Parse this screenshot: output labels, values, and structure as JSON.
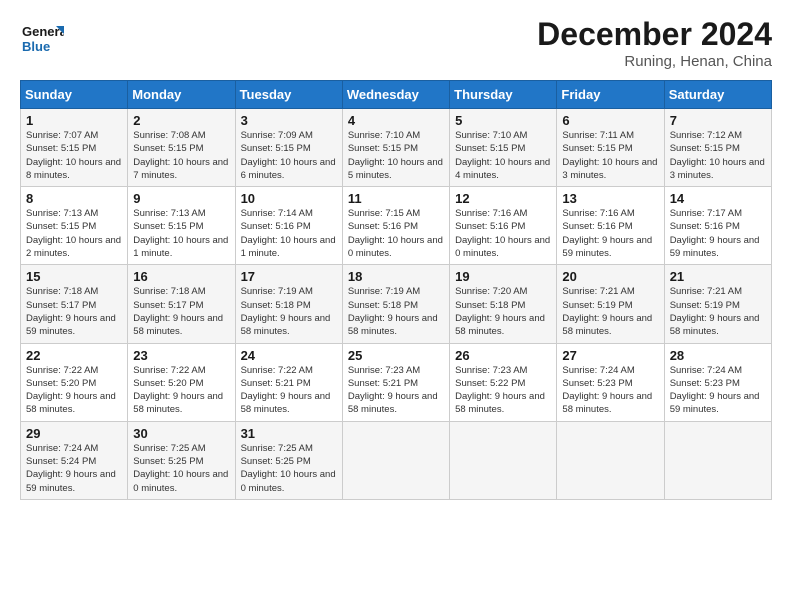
{
  "logo": {
    "general": "General",
    "blue": "Blue"
  },
  "header": {
    "title": "December 2024",
    "location": "Runing, Henan, China"
  },
  "weekdays": [
    "Sunday",
    "Monday",
    "Tuesday",
    "Wednesday",
    "Thursday",
    "Friday",
    "Saturday"
  ],
  "weeks": [
    [
      {
        "day": 1,
        "sunrise": "7:07 AM",
        "sunset": "5:15 PM",
        "daylight": "10 hours and 8 minutes."
      },
      {
        "day": 2,
        "sunrise": "7:08 AM",
        "sunset": "5:15 PM",
        "daylight": "10 hours and 7 minutes."
      },
      {
        "day": 3,
        "sunrise": "7:09 AM",
        "sunset": "5:15 PM",
        "daylight": "10 hours and 6 minutes."
      },
      {
        "day": 4,
        "sunrise": "7:10 AM",
        "sunset": "5:15 PM",
        "daylight": "10 hours and 5 minutes."
      },
      {
        "day": 5,
        "sunrise": "7:10 AM",
        "sunset": "5:15 PM",
        "daylight": "10 hours and 4 minutes."
      },
      {
        "day": 6,
        "sunrise": "7:11 AM",
        "sunset": "5:15 PM",
        "daylight": "10 hours and 3 minutes."
      },
      {
        "day": 7,
        "sunrise": "7:12 AM",
        "sunset": "5:15 PM",
        "daylight": "10 hours and 3 minutes."
      }
    ],
    [
      {
        "day": 8,
        "sunrise": "7:13 AM",
        "sunset": "5:15 PM",
        "daylight": "10 hours and 2 minutes."
      },
      {
        "day": 9,
        "sunrise": "7:13 AM",
        "sunset": "5:15 PM",
        "daylight": "10 hours and 1 minute."
      },
      {
        "day": 10,
        "sunrise": "7:14 AM",
        "sunset": "5:16 PM",
        "daylight": "10 hours and 1 minute."
      },
      {
        "day": 11,
        "sunrise": "7:15 AM",
        "sunset": "5:16 PM",
        "daylight": "10 hours and 0 minutes."
      },
      {
        "day": 12,
        "sunrise": "7:16 AM",
        "sunset": "5:16 PM",
        "daylight": "10 hours and 0 minutes."
      },
      {
        "day": 13,
        "sunrise": "7:16 AM",
        "sunset": "5:16 PM",
        "daylight": "9 hours and 59 minutes."
      },
      {
        "day": 14,
        "sunrise": "7:17 AM",
        "sunset": "5:16 PM",
        "daylight": "9 hours and 59 minutes."
      }
    ],
    [
      {
        "day": 15,
        "sunrise": "7:18 AM",
        "sunset": "5:17 PM",
        "daylight": "9 hours and 59 minutes."
      },
      {
        "day": 16,
        "sunrise": "7:18 AM",
        "sunset": "5:17 PM",
        "daylight": "9 hours and 58 minutes."
      },
      {
        "day": 17,
        "sunrise": "7:19 AM",
        "sunset": "5:18 PM",
        "daylight": "9 hours and 58 minutes."
      },
      {
        "day": 18,
        "sunrise": "7:19 AM",
        "sunset": "5:18 PM",
        "daylight": "9 hours and 58 minutes."
      },
      {
        "day": 19,
        "sunrise": "7:20 AM",
        "sunset": "5:18 PM",
        "daylight": "9 hours and 58 minutes."
      },
      {
        "day": 20,
        "sunrise": "7:21 AM",
        "sunset": "5:19 PM",
        "daylight": "9 hours and 58 minutes."
      },
      {
        "day": 21,
        "sunrise": "7:21 AM",
        "sunset": "5:19 PM",
        "daylight": "9 hours and 58 minutes."
      }
    ],
    [
      {
        "day": 22,
        "sunrise": "7:22 AM",
        "sunset": "5:20 PM",
        "daylight": "9 hours and 58 minutes."
      },
      {
        "day": 23,
        "sunrise": "7:22 AM",
        "sunset": "5:20 PM",
        "daylight": "9 hours and 58 minutes."
      },
      {
        "day": 24,
        "sunrise": "7:22 AM",
        "sunset": "5:21 PM",
        "daylight": "9 hours and 58 minutes."
      },
      {
        "day": 25,
        "sunrise": "7:23 AM",
        "sunset": "5:21 PM",
        "daylight": "9 hours and 58 minutes."
      },
      {
        "day": 26,
        "sunrise": "7:23 AM",
        "sunset": "5:22 PM",
        "daylight": "9 hours and 58 minutes."
      },
      {
        "day": 27,
        "sunrise": "7:24 AM",
        "sunset": "5:23 PM",
        "daylight": "9 hours and 58 minutes."
      },
      {
        "day": 28,
        "sunrise": "7:24 AM",
        "sunset": "5:23 PM",
        "daylight": "9 hours and 59 minutes."
      }
    ],
    [
      {
        "day": 29,
        "sunrise": "7:24 AM",
        "sunset": "5:24 PM",
        "daylight": "9 hours and 59 minutes."
      },
      {
        "day": 30,
        "sunrise": "7:25 AM",
        "sunset": "5:25 PM",
        "daylight": "10 hours and 0 minutes."
      },
      {
        "day": 31,
        "sunrise": "7:25 AM",
        "sunset": "5:25 PM",
        "daylight": "10 hours and 0 minutes."
      },
      null,
      null,
      null,
      null
    ]
  ],
  "labels": {
    "sunrise": "Sunrise:",
    "sunset": "Sunset:",
    "daylight": "Daylight:"
  }
}
